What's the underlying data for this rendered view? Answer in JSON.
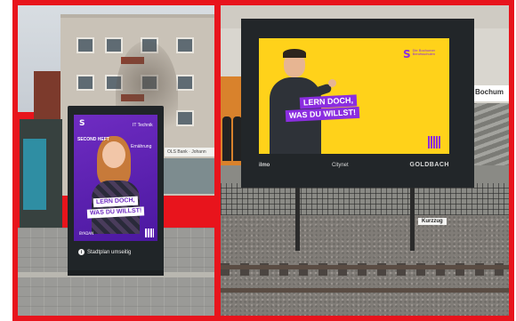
{
  "left_photo": {
    "poster": {
      "brand_mark": "S",
      "sticker_left": "SECOND HEFT",
      "sticker_top_right": "IT Technik",
      "sticker_right": "Ernährung",
      "headline_line1": "LERN DOCH,",
      "headline_line2": "WAS DU WILLST!",
      "footer": "BYADAN"
    },
    "kiosk_button": "Stadtplan umseitig",
    "shop_sign": "OLS Bank · Johann"
  },
  "right_photo": {
    "poster": {
      "brand_mark": "S",
      "brand_text_line1": "Die Bochumer",
      "brand_text_line2": "Berufsschulen",
      "headline_line1": "LERN DOCH,",
      "headline_line2": "WAS DU WILLST!"
    },
    "billboard_footer": {
      "left": "ilmo",
      "center": "Citynet",
      "right": "GOLDBACH"
    },
    "platform_sign": "Kurzzug",
    "station_sign": "Bochum"
  },
  "colors": {
    "frame_red": "#e8141c",
    "poster_purple": "#6f2cc2",
    "poster_yellow": "#ffd21a"
  }
}
